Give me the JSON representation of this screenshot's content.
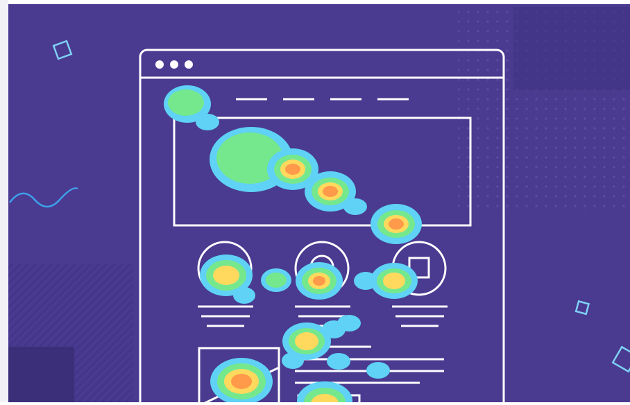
{
  "illustration": {
    "subject": "",
    "colors": {
      "background": "#4a3a90",
      "background_dark": "#3d2f7e",
      "outline": "#ffffff",
      "accent_line": "#3ea0ea",
      "decor_square": "#7fd1f5",
      "heat_outer": "#5fd2f5",
      "heat_mid": "#75e88e",
      "heat_inner": "#ffd95e",
      "heat_core": "#ff9a4a"
    },
    "icons": [
      "heatmap-blob",
      "browser-window-icon",
      "nav-line",
      "circle-icon",
      "square-icon"
    ]
  }
}
